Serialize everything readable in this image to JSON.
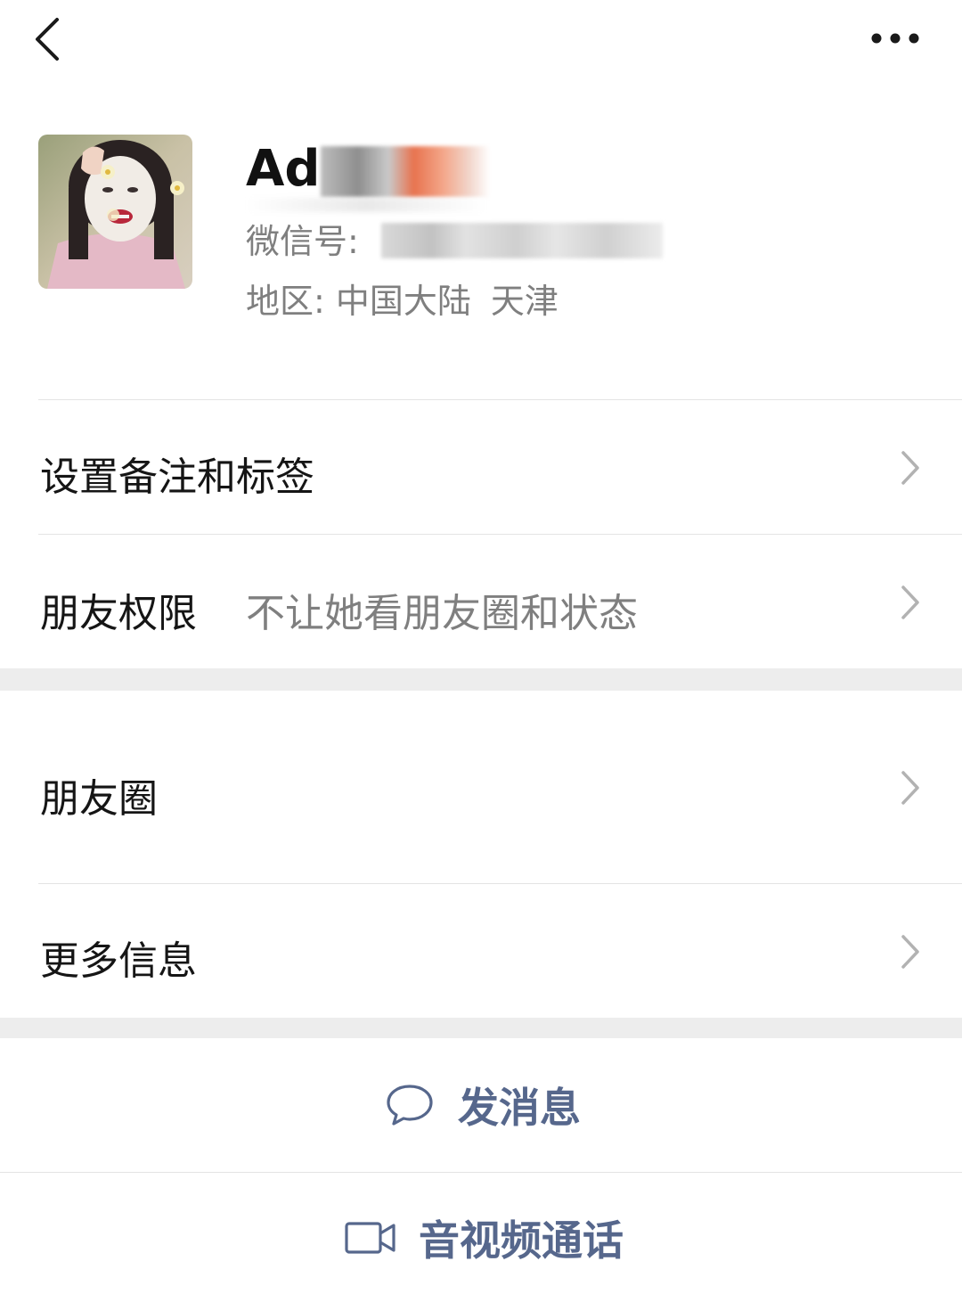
{
  "colors": {
    "accent_link": "#56678c",
    "secondary_text": "#7f7f7f",
    "separator": "#e4e4e4",
    "section_gap": "#ededed"
  },
  "topbar": {
    "back_icon": "chevron-left-icon",
    "more_icon": "ellipsis-icon"
  },
  "profile": {
    "nickname": "Ad",
    "wechat_id_label": "微信号:",
    "region_label": "地区:",
    "region_country": "中国大陆",
    "region_city": "天津"
  },
  "menu": {
    "remark_tags": "设置备注和标签",
    "friend_permission": "朋友权限",
    "friend_permission_value": "不让她看朋友圈和状态",
    "moments": "朋友圈",
    "more_info": "更多信息"
  },
  "actions": {
    "send_message": "发消息",
    "send_message_icon": "chat-bubble-icon",
    "av_call": "音视频通话",
    "av_call_icon": "video-camera-icon"
  }
}
